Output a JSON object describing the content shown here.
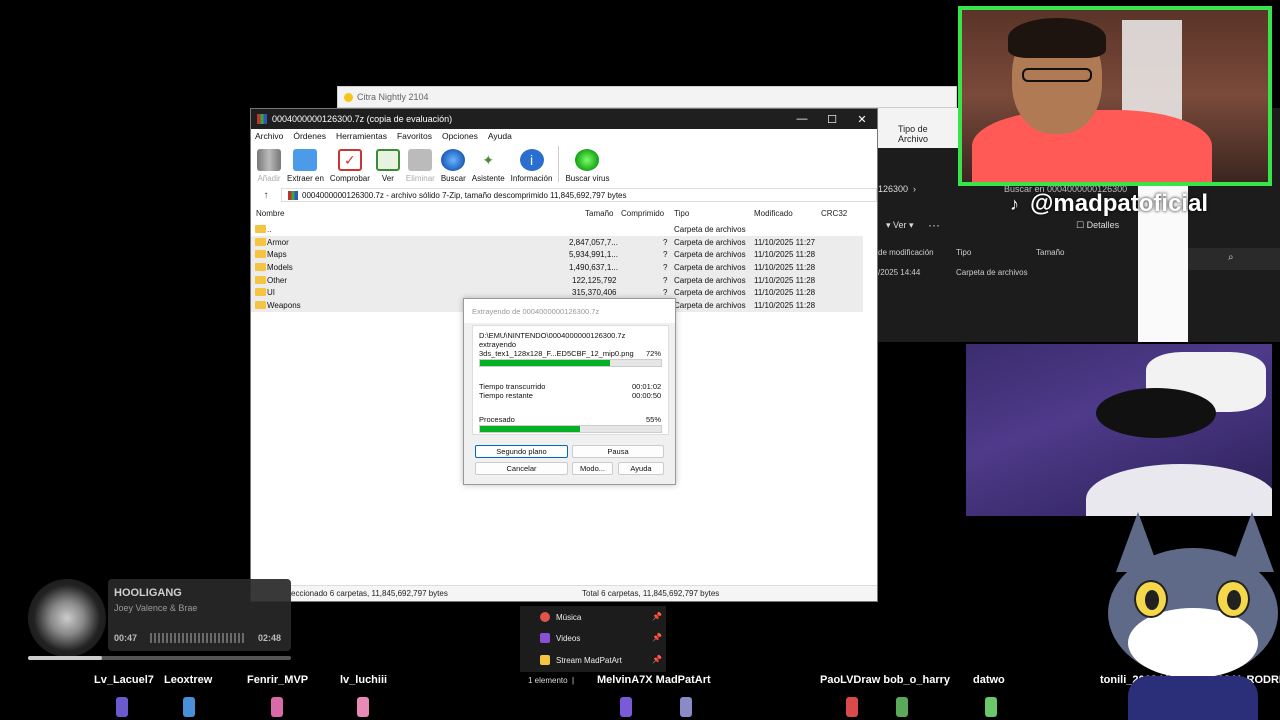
{
  "citra": {
    "title": "Citra Nightly 2104"
  },
  "explorer": {
    "tipo_header": "Tipo de Archivo",
    "path": "126300",
    "search": "Buscar en 0004000000126300",
    "ver": "Ver",
    "more": "···",
    "detalles": "Detalles",
    "col_modified": "de modificación",
    "col_tipo": "Tipo",
    "col_tamano": "Tamaño",
    "row_date": "/2025 14:44",
    "row_tipo": "Carpeta de archivos"
  },
  "tiktok": {
    "handle": "@madpatoficial"
  },
  "winrar": {
    "title": "0004000000126300.7z (copia de evaluación)",
    "menu": [
      "Archivo",
      "Órdenes",
      "Herramientas",
      "Favoritos",
      "Opciones",
      "Ayuda"
    ],
    "toolbar": [
      {
        "label": "Añadir",
        "icon": "add-icon",
        "disabled": true
      },
      {
        "label": "Extraer en",
        "icon": "extract-folder-icon",
        "disabled": false
      },
      {
        "label": "Comprobar",
        "icon": "test-icon",
        "disabled": false
      },
      {
        "label": "Ver",
        "icon": "view-book-icon",
        "disabled": false
      },
      {
        "label": "Eliminar",
        "icon": "trash-icon",
        "disabled": true
      },
      {
        "label": "Buscar",
        "icon": "magnifier-icon",
        "disabled": false
      },
      {
        "label": "Asistente",
        "icon": "wizard-icon",
        "disabled": false
      },
      {
        "label": "Información",
        "icon": "info-icon",
        "disabled": false
      },
      {
        "label": "Buscar virus",
        "icon": "virus-scan-icon",
        "disabled": false
      }
    ],
    "address": "0004000000126300.7z - archivo sólido 7-Zip, tamaño descomprimido 11,845,692,797 bytes",
    "columns": {
      "name": "Nombre",
      "size": "Tamaño",
      "compressed": "Comprimido",
      "type": "Tipo",
      "modified": "Modificado",
      "crc": "CRC32"
    },
    "files": [
      {
        "name": "..",
        "size": "",
        "compressed": "",
        "type": "Carpeta de archivos",
        "modified": "",
        "selected": false
      },
      {
        "name": "Armor",
        "size": "2,847,057,7...",
        "compressed": "?",
        "type": "Carpeta de archivos",
        "modified": "11/10/2025 11:27",
        "selected": true
      },
      {
        "name": "Maps",
        "size": "5,934,991,1...",
        "compressed": "?",
        "type": "Carpeta de archivos",
        "modified": "11/10/2025 11:28",
        "selected": true
      },
      {
        "name": "Models",
        "size": "1,490,637,1...",
        "compressed": "?",
        "type": "Carpeta de archivos",
        "modified": "11/10/2025 11:28",
        "selected": true
      },
      {
        "name": "Other",
        "size": "122,125,792",
        "compressed": "?",
        "type": "Carpeta de archivos",
        "modified": "11/10/2025 11:28",
        "selected": true
      },
      {
        "name": "UI",
        "size": "315,370,406",
        "compressed": "?",
        "type": "Carpeta de archivos",
        "modified": "11/10/2025 11:28",
        "selected": true
      },
      {
        "name": "Weapons",
        "size": "",
        "compressed": "",
        "type": "Carpeta de archivos",
        "modified": "11/10/2025 11:28",
        "selected": true
      }
    ],
    "status_left": "eccionado 6 carpetas, 11,845,692,797 bytes",
    "status_right": "Total 6 carpetas, 11,845,692,797 bytes"
  },
  "dialog": {
    "title": "Extrayendo de 0004000000126300.7z",
    "path": "D:\\EMU\\NINTENDO\\0004000000126300.7z",
    "action": "extrayendo",
    "file": "3ds_tex1_128x128_F...ED5CBF_12_mip0.png",
    "file_percent": "72%",
    "file_progress": 0.72,
    "elapsed_label": "Tiempo transcurrido",
    "elapsed": "00:01:02",
    "remaining_label": "Tiempo restante",
    "remaining": "00:00:50",
    "processed_label": "Procesado",
    "processed_percent": "55%",
    "processed_progress": 0.55,
    "buttons": {
      "background": "Segundo plano",
      "pause": "Pausa",
      "cancel": "Cancelar",
      "mode": "Modo...",
      "help": "Ayuda"
    }
  },
  "music": {
    "title": "HOOLIGANG",
    "artist": "Joey Valence & Brae",
    "elapsed": "00:47",
    "total": "02:48",
    "progress": 0.28
  },
  "quick_access": {
    "items": [
      {
        "label": "Música",
        "color": "#e0524a"
      },
      {
        "label": "Videos",
        "color": "#8a4fd6"
      },
      {
        "label": "Stream MadPatArt",
        "color": "#f5c542"
      }
    ],
    "count": "1 elemento"
  },
  "chat_names": [
    "Lv_Lacuel7",
    "Leoxtrew",
    "Fenrir_MVP",
    "lv_luchiii",
    "MelvinA7X MadPatArt",
    "PaoLVDraw bob_o_harry",
    "datwo",
    "tonili_2013 LV_gonzag03 V_RODRI"
  ]
}
